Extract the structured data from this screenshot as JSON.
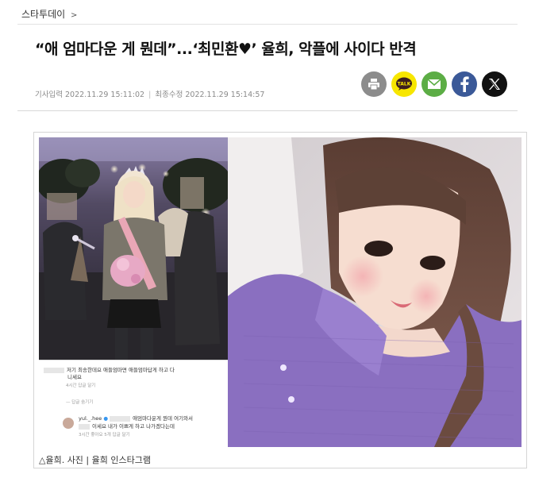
{
  "breadcrumb": {
    "section": "스타투데이",
    "chevron": ">"
  },
  "article": {
    "headline": "“애 엄마다운 게 뭔데”...‘최민환♥’ 율희, 악플에 사이다 반격",
    "published_label": "기사입력",
    "published": "2022.11.29 15:11:02",
    "modified_label": "최종수정",
    "modified": "2022.11.29 15:14:57"
  },
  "share": {
    "icons": [
      "print-icon",
      "kakaotalk-icon",
      "mail-icon",
      "facebook-icon",
      "x-icon"
    ],
    "kakao_text": "TALK",
    "colors": {
      "print": "#8c8c8c",
      "kakao": "#f7e600",
      "mail": "#5cad45",
      "facebook": "#3b5998",
      "x": "#111111"
    }
  },
  "figure": {
    "comments": {
      "c1_text": "저기 최송한데요 애들엄마면 애들엄마답게 하고 다",
      "c1_text2": "니세요",
      "c1_meta": "4시간   답글 달기",
      "hide_replies": "— 답글 숨기기",
      "reply_user": "yul._.hee",
      "reply_text": "애엄마다운게 뭔데 여기와서",
      "reply_text2": "이세요 내가 이쁘게 하고 나가겠다는데",
      "reply_meta": "3시간   좋아요 5개   답글 달기"
    },
    "caption": "△율희. 사진 | 율희 인스타그램"
  }
}
